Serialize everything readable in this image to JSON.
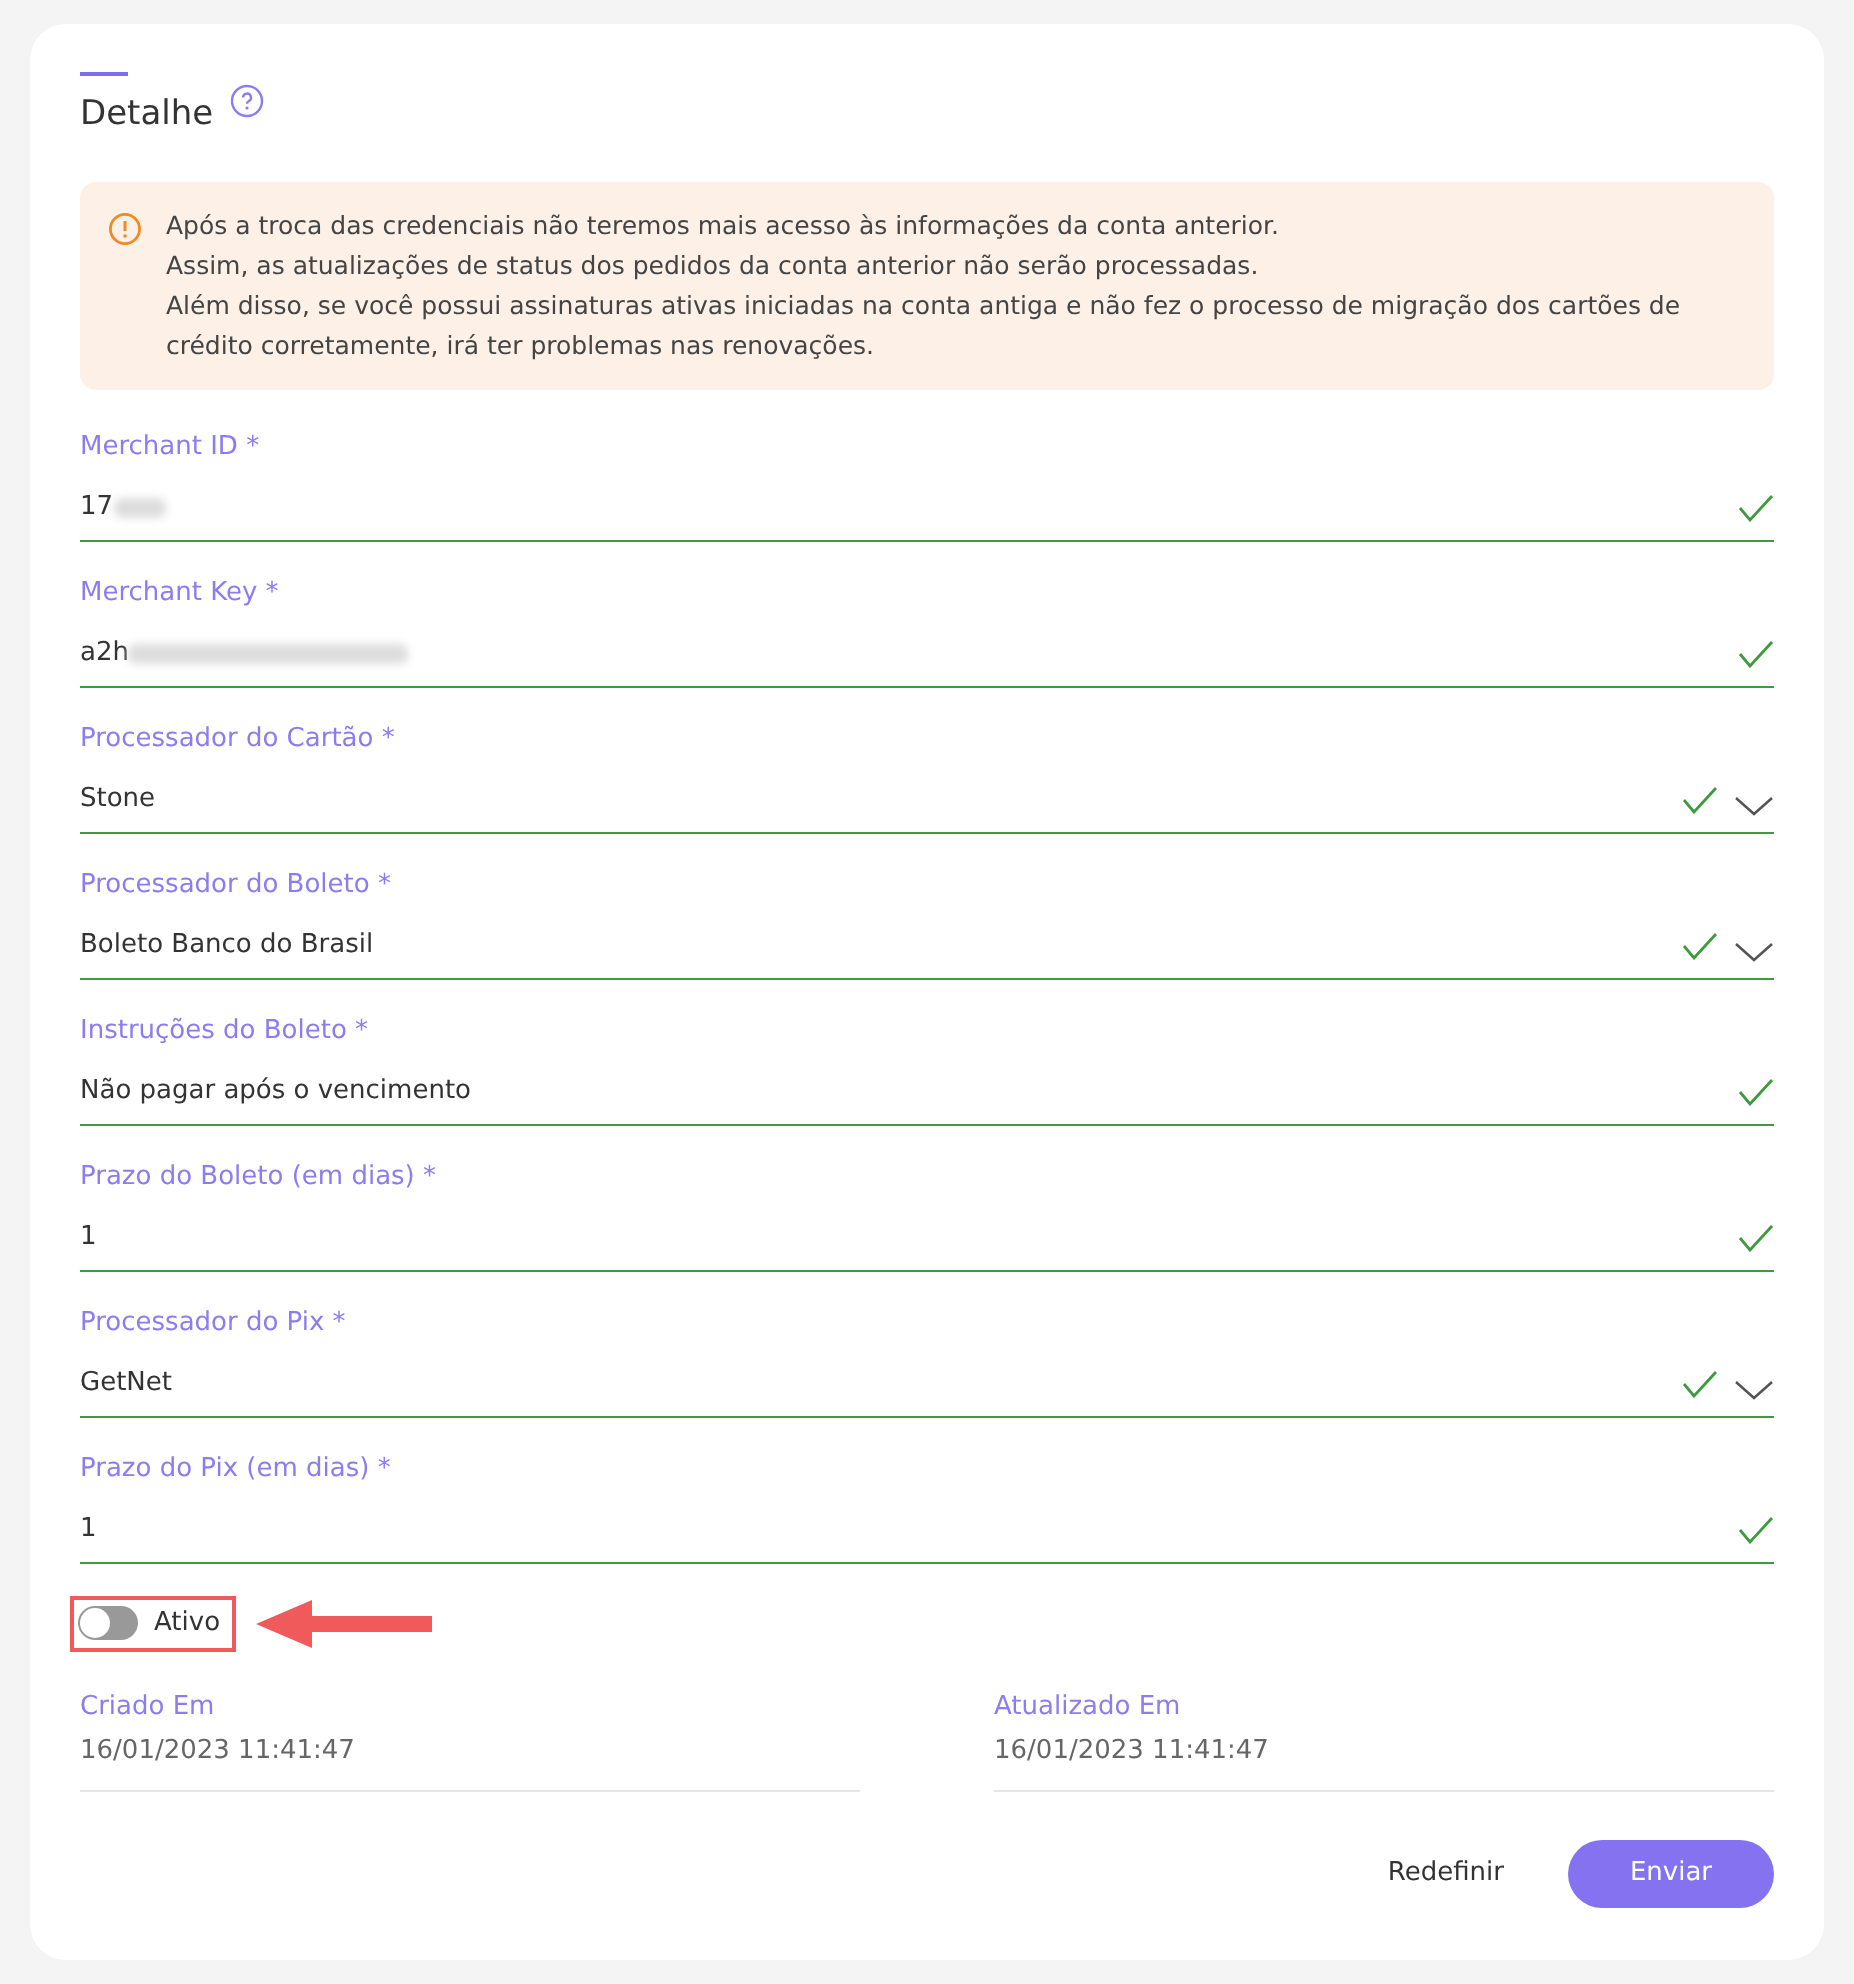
{
  "header": {
    "title": "Detalhe"
  },
  "alert": {
    "lines": [
      "Após a troca das credenciais não teremos mais acesso às informações da conta anterior.",
      "Assim, as atualizações de status dos pedidos da conta anterior não serão processadas.",
      "Além disso, se você possui assinaturas ativas iniciadas na conta antiga e não fez o processo de migração dos cartões de crédito corretamente, irá ter problemas nas renovações."
    ]
  },
  "fields": [
    {
      "kind": "text",
      "label": "Merchant ID *",
      "value": "17",
      "redacted": true,
      "valid": true
    },
    {
      "kind": "text",
      "label": "Merchant Key *",
      "value": "a2h",
      "redacted": true,
      "valid": true
    },
    {
      "kind": "select",
      "label": "Processador do Cartão *",
      "value": "Stone",
      "valid": true
    },
    {
      "kind": "select",
      "label": "Processador do Boleto *",
      "value": "Boleto Banco do Brasil",
      "valid": true
    },
    {
      "kind": "text",
      "label": "Instruções do Boleto *",
      "value": "Não pagar após o vencimento",
      "valid": true
    },
    {
      "kind": "text",
      "label": "Prazo do Boleto (em dias) *",
      "value": "1",
      "valid": true
    },
    {
      "kind": "select",
      "label": "Processador do Pix *",
      "value": "GetNet",
      "valid": true
    },
    {
      "kind": "text",
      "label": "Prazo do Pix (em dias) *",
      "value": "1",
      "valid": true
    }
  ],
  "toggle": {
    "label": "Ativo",
    "on": false,
    "highlighted": true
  },
  "meta": [
    {
      "label": "Criado Em",
      "value": "16/01/2023 11:41:47"
    },
    {
      "label": "Atualizado Em",
      "value": "16/01/2023 11:41:47"
    }
  ],
  "buttons": {
    "reset": "Redefinir",
    "submit": "Enviar"
  }
}
